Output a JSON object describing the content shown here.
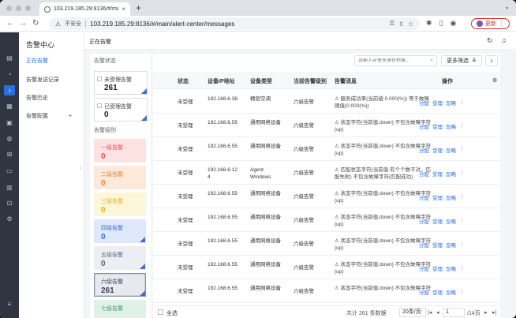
{
  "browser": {
    "tab_title": "103.219.185.29:8136/#/main/a",
    "address_warning": "不安全",
    "url": "103.219.185.29:8136/#/main/alert-center/messages",
    "update_label": "更新"
  },
  "subnav": {
    "title": "告警中心",
    "items": [
      {
        "label": "正在告警"
      },
      {
        "label": "告警发送记录"
      },
      {
        "label": "告警历史"
      },
      {
        "label": "告警配置"
      }
    ]
  },
  "page": {
    "title": "正在告警"
  },
  "status_filter": {
    "title": "告警状态",
    "cards": [
      {
        "label": "未受理告警",
        "count": "261"
      },
      {
        "label": "已受理告警",
        "count": "0"
      }
    ]
  },
  "level_filter": {
    "title": "告警级别",
    "levels": [
      {
        "label": "一级告警",
        "count": "0",
        "bg": "#fde2e2",
        "color": "#e05252"
      },
      {
        "label": "二级告警",
        "count": "0",
        "bg": "#fde9d9",
        "color": "#e8842c"
      },
      {
        "label": "三级告警",
        "count": "0",
        "bg": "#fdf6d8",
        "color": "#e0b020"
      },
      {
        "label": "四级告警",
        "count": "0",
        "bg": "#dfe8fb",
        "color": "#3a6fd8"
      },
      {
        "label": "五级告警",
        "count": "0",
        "bg": "#eceef3",
        "color": "#5a6478"
      },
      {
        "label": "六级告警",
        "count": "261",
        "bg": "#e7e9ef",
        "color": "#3b4356"
      },
      {
        "label": "七级告警",
        "count": "",
        "bg": "#e0f1ea",
        "color": "#3c9a72"
      }
    ]
  },
  "toolbar": {
    "search_placeholder": "请输入告警来源名称搜...",
    "more_filters": "更多筛选"
  },
  "table": {
    "headers": {
      "status": "状态",
      "ip": "设备IP地址",
      "type": "设备类型",
      "level": "当前告警级别",
      "message": "告警消息",
      "ops": "操作"
    },
    "op_labels": {
      "assign": "分配",
      "accept": "受理",
      "ignore": "忽略"
    },
    "rows": [
      {
        "status": "未受理",
        "ip1": "192.168.6.38",
        "ip2": "",
        "type1": "精密空调",
        "type2": "",
        "level": "六级告警",
        "msg1": "⚠ 服务成功率(当前值:0.000(%)) 等于故障",
        "msg2": "阈值(0.000(%))"
      },
      {
        "status": "未受理",
        "ip1": "192.168.6.55",
        "ip2": "",
        "type1": "通用网络设备",
        "type2": "",
        "level": "六级告警",
        "msg1": "⚠ 状态字符(当前值:down) 不包含故障字符",
        "msg2": "(up)"
      },
      {
        "status": "未受理",
        "ip1": "192.168.6.55",
        "ip2": "",
        "type1": "通用网络设备",
        "type2": "",
        "level": "六级告警",
        "msg1": "⚠ 状态字符(当前值:down) 不包含故障字符",
        "msg2": "(up)"
      },
      {
        "status": "未受理",
        "ip1": "192.168.6.12",
        "ip2": "4",
        "type1": "Agent",
        "type2": "Windows",
        "level": "六级告警",
        "msg1": "⚠ 匹配状态字符(当前值:有个个数不对，匹",
        "msg2": "配失败) 不包含故障字符(匹配成功)"
      },
      {
        "status": "未受理",
        "ip1": "192.168.6.55",
        "ip2": "",
        "type1": "通用网络设备",
        "type2": "",
        "level": "六级告警",
        "msg1": "⚠ 状态字符(当前值:down) 不包含故障字符",
        "msg2": "(up)"
      },
      {
        "status": "未受理",
        "ip1": "192.168.6.55",
        "ip2": "",
        "type1": "通用网络设备",
        "type2": "",
        "level": "六级告警",
        "msg1": "⚠ 状态字符(当前值:down) 不包含故障字符",
        "msg2": "(up)"
      },
      {
        "status": "未受理",
        "ip1": "192.168.6.55",
        "ip2": "",
        "type1": "通用网络设备",
        "type2": "",
        "level": "六级告警",
        "msg1": "⚠ 状态字符(当前值:down) 不包含故障字符",
        "msg2": "(up)"
      },
      {
        "status": "未受理",
        "ip1": "192.168.6.55",
        "ip2": "",
        "type1": "通用网络设备",
        "type2": "",
        "level": "六级告警",
        "msg1": "⚠ 状态字符(当前值:down) 不包含故障字符",
        "msg2": "(up)"
      },
      {
        "status": "未受理",
        "ip1": "192.168.6.55",
        "ip2": "",
        "type1": "通用网络设备",
        "type2": "",
        "level": "六级告警",
        "msg1": "⚠ 状态字符(当前值:down) 不包含故障字符",
        "msg2": ""
      }
    ]
  },
  "footer": {
    "select_all": "全选",
    "total": "共计 261 条数据",
    "page_size": "20条/页",
    "current_page": "1",
    "page_count": "/14页"
  },
  "icons": {
    "rail": [
      "dashboard-icon",
      "monitor-icon",
      "bell-icon",
      "database-icon",
      "screen-icon",
      "globe-icon",
      "topology-icon",
      "display-icon",
      "chart-icon",
      "grid-icon",
      "settings-icon",
      "menu-icon"
    ]
  }
}
